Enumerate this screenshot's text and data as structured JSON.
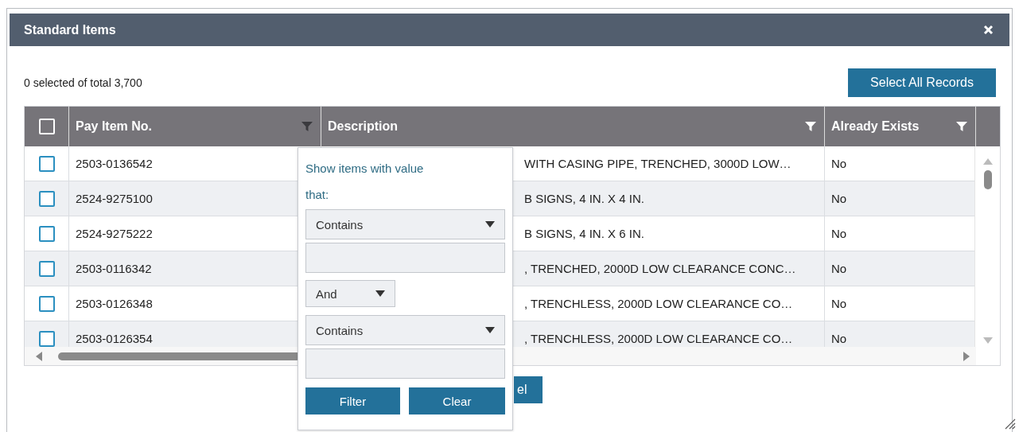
{
  "window": {
    "title": "Standard Items"
  },
  "selection_summary": "0 selected of total 3,700",
  "select_all_button": "Select All Records",
  "table": {
    "all_checked": false,
    "columns": [
      {
        "label": "Pay Item No.",
        "filter_open": true
      },
      {
        "label": "Description",
        "filter_open": false
      },
      {
        "label": "Already Exists",
        "filter_open": false
      }
    ],
    "rows": [
      {
        "checked": false,
        "pay_item_no": "2503-0136542",
        "description": "WITH CASING PIPE, TRENCHED, 3000D LOW…",
        "already_exists": "No"
      },
      {
        "checked": false,
        "pay_item_no": "2524-9275100",
        "description": "B SIGNS, 4 IN. X 4 IN.",
        "already_exists": "No"
      },
      {
        "checked": false,
        "pay_item_no": "2524-9275222",
        "description": "B SIGNS, 4 IN. X 6 IN.",
        "already_exists": "No"
      },
      {
        "checked": false,
        "pay_item_no": "2503-0116342",
        "description": ", TRENCHED, 2000D LOW CLEARANCE CONC…",
        "already_exists": "No"
      },
      {
        "checked": false,
        "pay_item_no": "2503-0126348",
        "description": ", TRENCHLESS, 2000D LOW CLEARANCE CO…",
        "already_exists": "No"
      },
      {
        "checked": false,
        "pay_item_no": "2503-0126354",
        "description": ", TRENCHLESS, 2000D LOW CLEARANCE CO…",
        "already_exists": "No"
      }
    ]
  },
  "filter_menu": {
    "prompt": "Show items with value that:",
    "conditions": [
      {
        "operator": "Contains"
      },
      {
        "operator": "Contains"
      }
    ],
    "logic": "And",
    "buttons": [
      {
        "label": "Filter"
      },
      {
        "label": "Clear"
      }
    ]
  },
  "footer_button": "el"
}
